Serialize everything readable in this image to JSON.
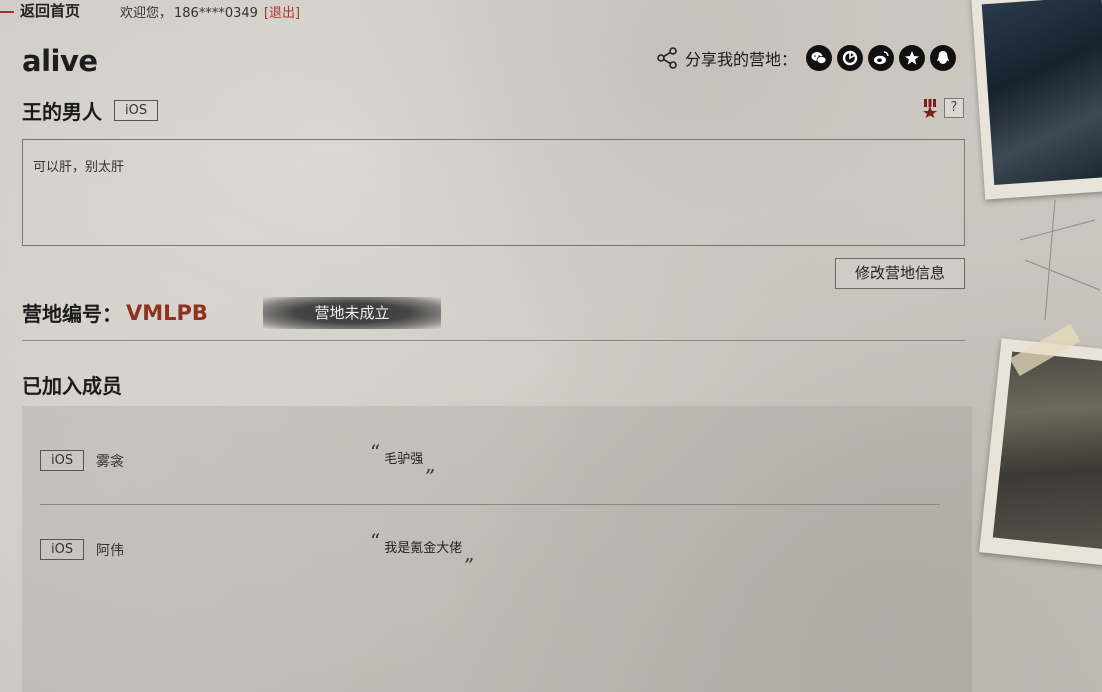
{
  "topbar": {
    "back_label": "返回首页",
    "welcome_prefix": "欢迎您，",
    "phone": "186****0349",
    "logout_label": "[退出]"
  },
  "camp": {
    "name": "alive",
    "owner_name": "王的男人",
    "owner_platform": "iOS",
    "description": "可以肝，别太肝",
    "edit_label": "修改营地信息",
    "id_label": "营地编号：",
    "id_value": "VMLPB",
    "status": "营地未成立"
  },
  "share": {
    "label": "分享我的营地：",
    "icons": [
      "wechat-icon",
      "wechat-moments-icon",
      "weibo-icon",
      "qzone-icon",
      "qq-icon"
    ]
  },
  "badges": {
    "rank_icon": "rank-chevron-icon",
    "help_label": "?"
  },
  "members": {
    "title": "已加入成员",
    "items": [
      {
        "platform": "iOS",
        "name": "雾衾",
        "quote": "毛驴强"
      },
      {
        "platform": "iOS",
        "name": "阿伟",
        "quote": "我是氪金大佬"
      }
    ]
  },
  "quote_marks": {
    "open": "“",
    "close": "„"
  },
  "colors": {
    "accent_red": "#8e3222",
    "logout_red": "#b0352c",
    "background": "#cfcbc4",
    "status_badge": "#3a3a3a"
  }
}
